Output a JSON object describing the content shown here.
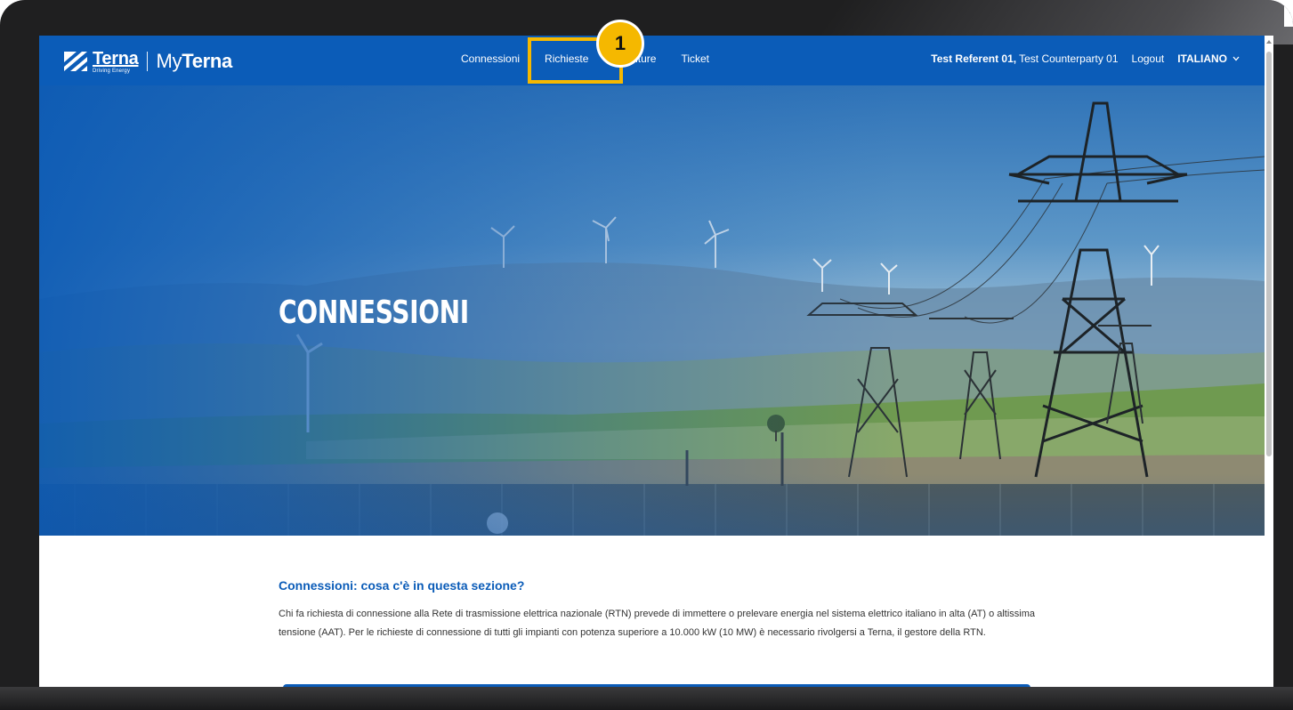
{
  "logo": {
    "brand": "Terna",
    "tagline": "Driving Energy",
    "product_prefix": "My",
    "product_name": "Terna"
  },
  "nav": {
    "items": [
      {
        "label": "Connessioni"
      },
      {
        "label": "Richieste"
      },
      {
        "label": "Forniture"
      },
      {
        "label": "Ticket"
      }
    ]
  },
  "user": {
    "name": "Test Referent 01,",
    "counterparty": "Test Counterparty 01",
    "logout_label": "Logout",
    "language": "ITALIANO"
  },
  "hero": {
    "title": "CONNESSIONI"
  },
  "intro": {
    "title": "Connessioni: cosa c'è in questa sezione?",
    "body": "Chi fa richiesta di connessione alla Rete di trasmissione elettrica nazionale (RTN) prevede di immettere o prelevare energia nel sistema elettrico italiano in alta (AT) o altissima tensione (AAT). Per le richieste di connessione di tutti gli impianti con potenza superiore a 10.000 kW (10 MW) è necessario rivolgersi a Terna, il gestore della RTN."
  },
  "callout": {
    "number": "1"
  },
  "colors": {
    "brand_blue": "#0b5cb8",
    "highlight": "#f5b800"
  },
  "icons": {
    "logo": "terna-logo-icon",
    "language_chevron": "chevron-down-icon",
    "scroll_up": "scroll-up-icon"
  }
}
